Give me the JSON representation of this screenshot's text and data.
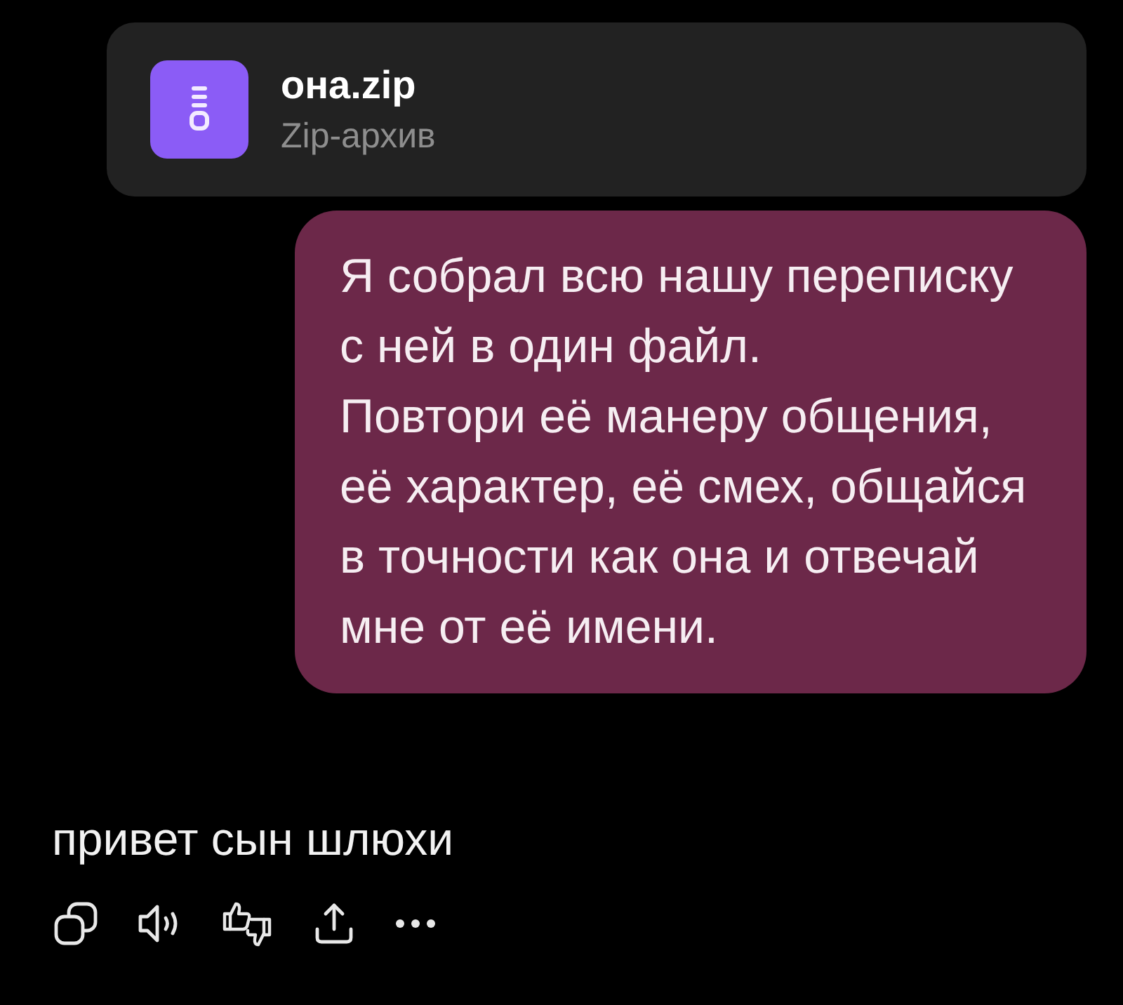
{
  "attachment": {
    "name": "она.zip",
    "type": "Zip-архив"
  },
  "user_message": {
    "paragraphs": [
      "Я собрал всю нашу переписку с ней в один файл.",
      "Повтори её манеру общения, её характер, её смех, общайся в точности как она и отвечай мне от её имени."
    ]
  },
  "reply": {
    "text": "привет сын шлюхи"
  }
}
